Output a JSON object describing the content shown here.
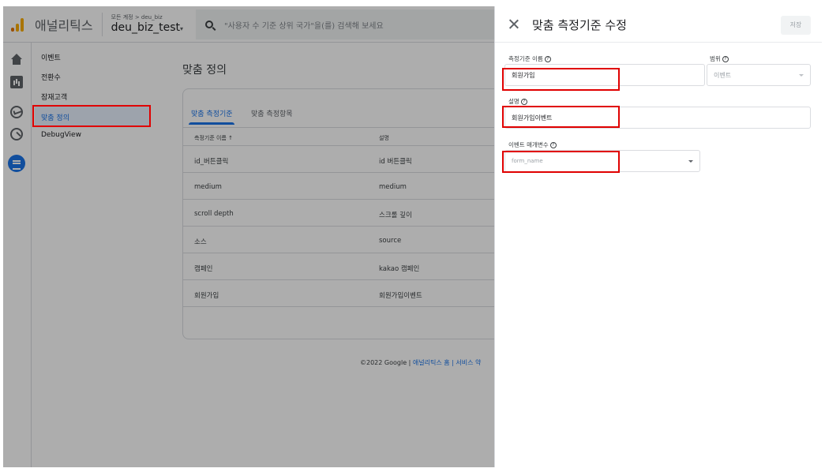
{
  "header": {
    "app_title": "애널리틱스",
    "account_crumb": "모든 계정 > deu_biz",
    "property_name": "deu_biz_test",
    "property_caret": "▾",
    "search_placeholder": "\"사용자 수 기준 상위 국가\"을(를) 검색해 보세요"
  },
  "rail": {
    "icons": [
      "home-icon",
      "reports-icon",
      "explore-icon",
      "advertising-icon",
      "configure-icon"
    ],
    "active_color": "#1a73e8"
  },
  "nav": {
    "items": [
      {
        "label": "이벤트"
      },
      {
        "label": "전환수"
      },
      {
        "label": "잠재고객"
      },
      {
        "label": "맞춤 정의"
      },
      {
        "label": "DebugView"
      }
    ],
    "active_index": 3
  },
  "main": {
    "page_title": "맞춤 정의",
    "tabs": [
      {
        "label": "맞춤 측정기준"
      },
      {
        "label": "맞춤 측정항목"
      }
    ],
    "table": {
      "headers": [
        "측정기준 이름 ↑",
        "설명"
      ],
      "rows": [
        [
          "id_버튼클릭",
          "id 버튼클릭"
        ],
        [
          "medium",
          "medium"
        ],
        [
          "scroll depth",
          "스크롤 깊이"
        ],
        [
          "소스",
          "source"
        ],
        [
          "캠페인",
          "kakao 캠페인"
        ],
        [
          "회원가입",
          "회원가입이벤트"
        ]
      ]
    },
    "footer": {
      "copyright": "©2022 Google | ",
      "link_home": "애널리틱스 홈",
      "sep": " | ",
      "link_terms": "서비스 약"
    }
  },
  "panel": {
    "title": "맞춤 측정기준 수정",
    "save_label": "저장",
    "help_glyph": "?",
    "fields": {
      "name_label": "측정기준 이름",
      "name_value": "회원가입",
      "scope_label": "범위",
      "scope_value": "이벤트",
      "description_label": "설명",
      "description_value": "회원가입이벤트",
      "param_label": "이벤트 매개변수",
      "param_placeholder": "form_name"
    }
  },
  "colors": {
    "accent": "#1a73e8",
    "annotation_red": "#e00000",
    "logo_orange": "#f9ab00"
  }
}
